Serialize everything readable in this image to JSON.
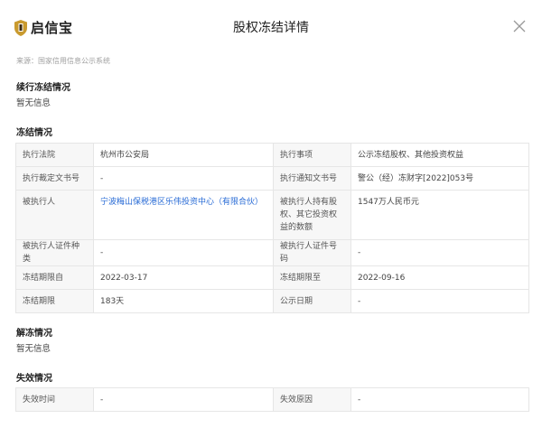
{
  "header": {
    "brand": "启信宝",
    "title": "股权冻结详情"
  },
  "source": "来源：国家信用信息公示系统",
  "sections": {
    "continue": {
      "title": "续行冻结情况",
      "empty": "暂无信息"
    },
    "freeze": {
      "title": "冻结情况"
    },
    "unfreeze": {
      "title": "解冻情况",
      "empty": "暂无信息"
    },
    "invalid": {
      "title": "失效情况"
    }
  },
  "freeze_table": {
    "rows": [
      [
        "执行法院",
        "杭州市公安局",
        "执行事项",
        "公示冻结股权、其他投资权益"
      ],
      [
        "执行裁定文书号",
        "-",
        "执行通知文书号",
        "警公（经）冻财字[2022]053号"
      ],
      [
        "被执行人",
        "宁波梅山保税港区乐伟投资中心（有限合伙）",
        "被执行人持有股权、其它投资权益的数额",
        "1547万人民币元"
      ],
      [
        "被执行人证件种类",
        "-",
        "被执行人证件号码",
        "-"
      ],
      [
        "冻结期限自",
        "2022-03-17",
        "冻结期限至",
        "2022-09-16"
      ],
      [
        "冻结期限",
        "183天",
        "公示日期",
        "-"
      ]
    ]
  },
  "invalid_table": {
    "rows": [
      [
        "失效时间",
        "-",
        "失效原因",
        "-"
      ]
    ]
  },
  "colors": {
    "link": "#2a6cd6",
    "label_bg": "#f7f7f7",
    "border": "#e6e6e6",
    "brand_gold": "#c99a2e"
  },
  "icons": {
    "logo": "shield-logo-icon",
    "close": "close-icon"
  }
}
